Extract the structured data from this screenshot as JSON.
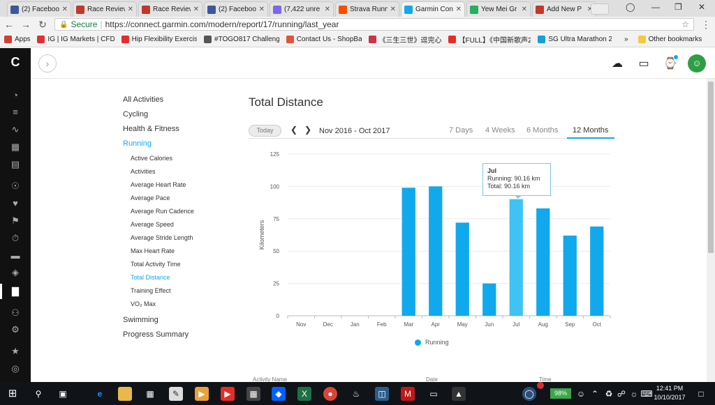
{
  "browser": {
    "tabs": [
      {
        "title": "(2) Faceboo",
        "icon_color": "#3b5998"
      },
      {
        "title": "Race Review",
        "icon_color": "#c0392b"
      },
      {
        "title": "Race Review",
        "icon_color": "#c0392b"
      },
      {
        "title": "(2) Faceboo",
        "icon_color": "#3b5998"
      },
      {
        "title": "(7,422 unre",
        "icon_color": "#7b68ee"
      },
      {
        "title": "Strava Runn",
        "icon_color": "#fc4c02"
      },
      {
        "title": "Garmin Con",
        "icon_color": "#11a9ed"
      },
      {
        "title": "Yew Mei Gr",
        "icon_color": "#27ae60"
      },
      {
        "title": "Add New P",
        "icon_color": "#c0392b"
      }
    ],
    "secure_label": "Secure",
    "url": "https://connect.garmin.com/modern/report/17/running/last_year",
    "bookmarks": [
      {
        "label": "Apps",
        "color": "#d04030"
      },
      {
        "label": "IG | IG Markets | CFD",
        "color": "#e03030"
      },
      {
        "label": "Hip Flexibility Exercis",
        "color": "#e52d27"
      },
      {
        "label": "#TOGO817 Challeng",
        "color": "#555555"
      },
      {
        "label": "Contact Us - ShopBa",
        "color": "#e0553a"
      },
      {
        "label": "《三生三世》逗完心",
        "color": "#cc3344"
      },
      {
        "label": "【FULL】《中国新歌声2",
        "color": "#e52d27"
      },
      {
        "label": "SG Ultra Marathon 2",
        "color": "#1a9fd8"
      }
    ],
    "bookmarks_more": "»",
    "other_bookmarks": "Other bookmarks"
  },
  "report_nav": {
    "groups": [
      {
        "label": "All Activities",
        "selected": false
      },
      {
        "label": "Cycling",
        "selected": false
      },
      {
        "label": "Health & Fitness",
        "selected": false
      },
      {
        "label": "Running",
        "selected": true
      }
    ],
    "running_reports": [
      {
        "label": "Active Calories",
        "selected": false
      },
      {
        "label": "Activities",
        "selected": false
      },
      {
        "label": "Average Heart Rate",
        "selected": false
      },
      {
        "label": "Average Pace",
        "selected": false
      },
      {
        "label": "Average Run Cadence",
        "selected": false
      },
      {
        "label": "Average Speed",
        "selected": false
      },
      {
        "label": "Average Stride Length",
        "selected": false
      },
      {
        "label": "Max Heart Rate",
        "selected": false
      },
      {
        "label": "Total Activity Time",
        "selected": false
      },
      {
        "label": "Total Distance",
        "selected": true
      },
      {
        "label": "Training Effect",
        "selected": false
      },
      {
        "label": "VO₂ Max",
        "selected": false
      }
    ],
    "after": [
      {
        "label": "Swimming",
        "selected": false
      },
      {
        "label": "Progress Summary",
        "selected": false
      }
    ]
  },
  "report": {
    "title": "Total Distance",
    "today_label": "Today",
    "date_range": "Nov 2016 - Oct 2017",
    "periods": [
      {
        "label": "7 Days",
        "selected": false
      },
      {
        "label": "4 Weeks",
        "selected": false
      },
      {
        "label": "6 Months",
        "selected": false
      },
      {
        "label": "12 Months",
        "selected": true
      }
    ],
    "tooltip": {
      "month": "Jul",
      "running": "Running: 90.16 km",
      "total": "Total: 90.16 km"
    },
    "table_headers": [
      "Activity Name",
      "Date",
      "Time"
    ]
  },
  "chart_data": {
    "type": "bar",
    "categories": [
      "Nov",
      "Dec",
      "Jan",
      "Feb",
      "Mar",
      "Apr",
      "May",
      "Jun",
      "Jul",
      "Aug",
      "Sep",
      "Oct"
    ],
    "series": [
      {
        "name": "Running",
        "values": [
          0,
          0,
          0,
          0,
          99,
          100,
          72,
          25,
          90.16,
          83,
          62,
          69
        ],
        "color": "#11a9ed"
      }
    ],
    "ylabel": "Kilometers",
    "ylim": [
      0,
      125
    ],
    "yticks": [
      0,
      25,
      50,
      75,
      100,
      125
    ],
    "grid": true,
    "legend": "bottom",
    "highlight_color": "#3fc3f5"
  },
  "taskbar": {
    "battery": "98%",
    "time": "12:41 PM",
    "date": "10/10/2017"
  }
}
